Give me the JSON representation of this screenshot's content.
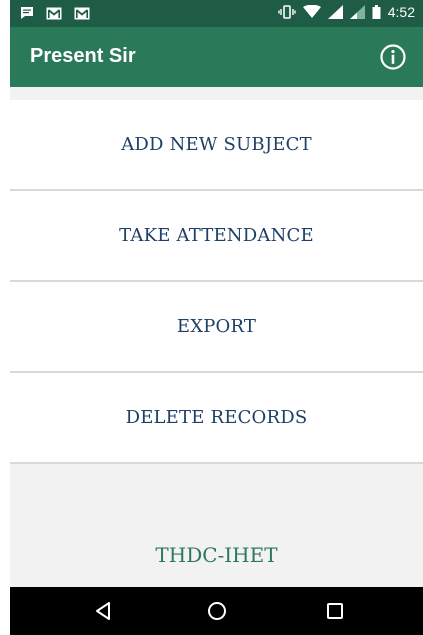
{
  "status_bar": {
    "time": "4:52",
    "left_icons": [
      "message-icon",
      "gmail-icon",
      "gmail-icon"
    ],
    "right_icons": [
      "vibrate-icon",
      "wifi-icon",
      "signal-icon",
      "signal-weak-icon",
      "battery-icon"
    ]
  },
  "app_bar": {
    "title": "Present Sir",
    "action_icon": "info-icon"
  },
  "menu": {
    "items": [
      {
        "label": "ADD NEW SUBJECT"
      },
      {
        "label": "TAKE ATTENDANCE"
      },
      {
        "label": "EXPORT"
      },
      {
        "label": "DELETE RECORDS"
      }
    ]
  },
  "footer": {
    "brand": "THDC-IHET"
  },
  "nav_bar": {
    "icons": [
      "back-icon",
      "home-icon",
      "recents-icon"
    ]
  },
  "colors": {
    "status_bar": "#1f5c46",
    "app_bar": "#2a7a5a",
    "menu_text": "#1e3f66",
    "brand_text": "#2a7a5a",
    "background": "#f2f2f2",
    "nav_bar": "#000000"
  }
}
